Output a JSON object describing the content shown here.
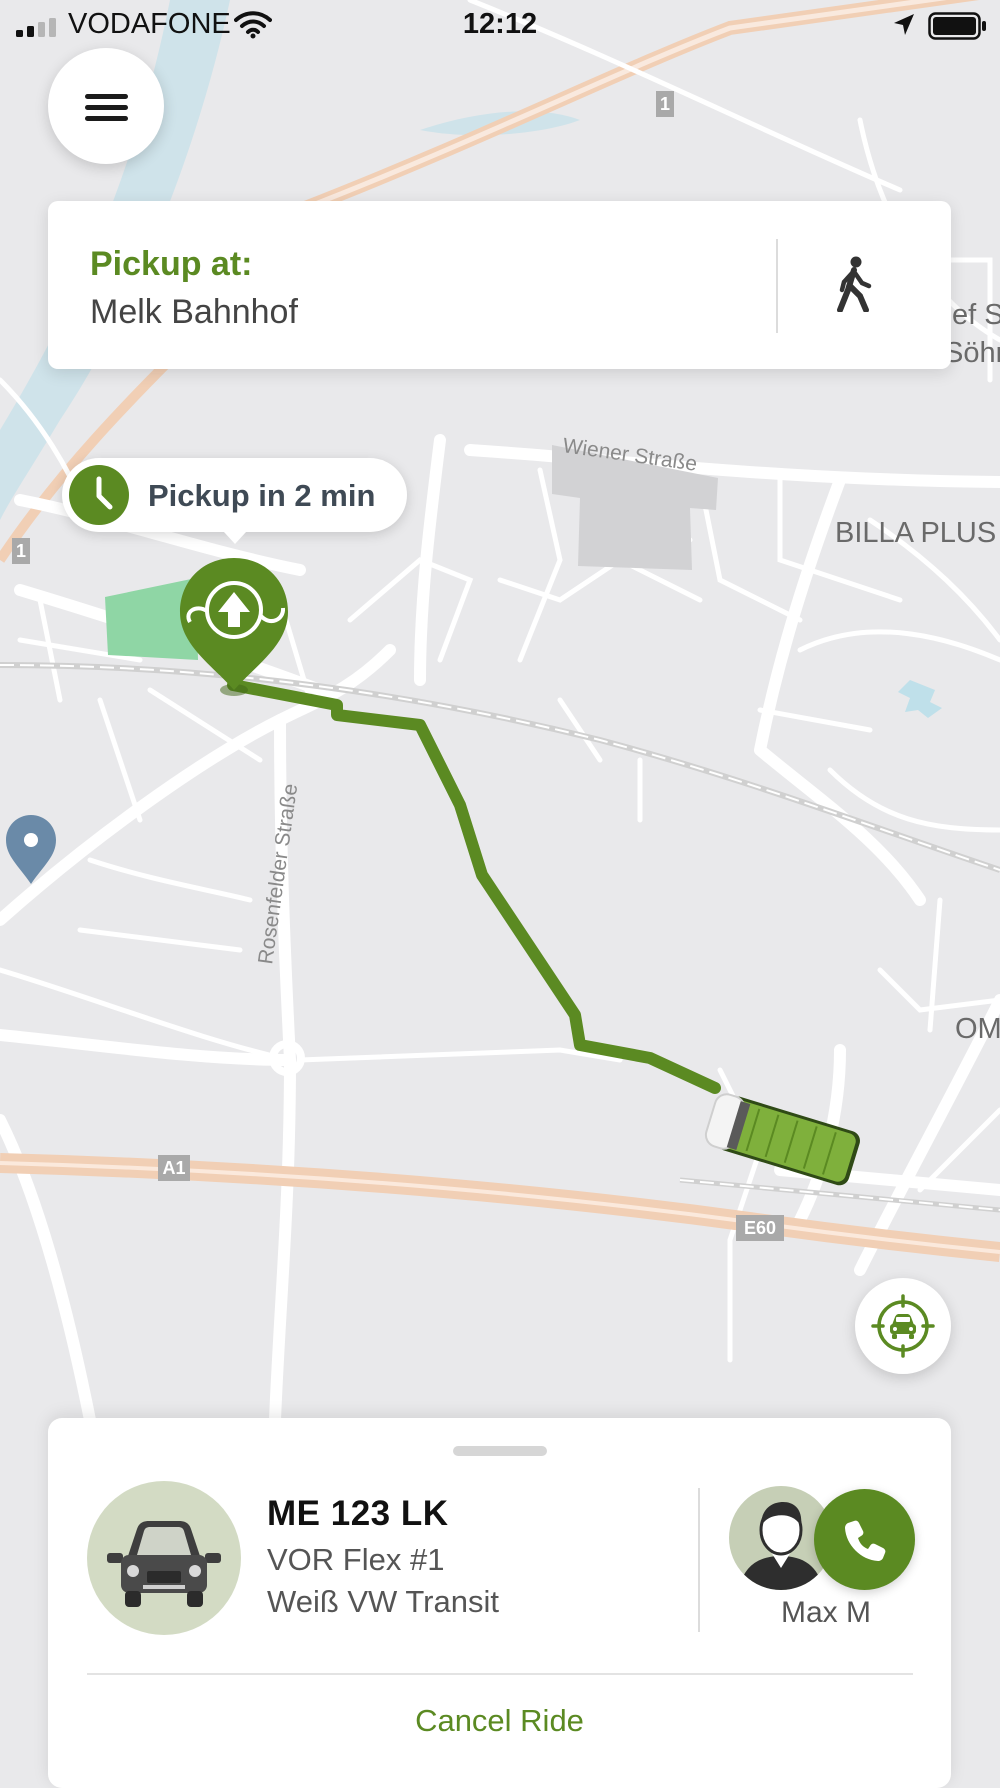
{
  "status_bar": {
    "carrier": "VODAFONE",
    "time": "12:12",
    "icons": [
      "signal-icon",
      "wifi-icon",
      "location-arrow-icon",
      "battery-icon"
    ]
  },
  "map": {
    "street_labels": [
      "Wiener Straße",
      "Rosenfelder Straße"
    ],
    "place_labels": [
      "BILLA PLUS",
      "OM",
      "ef S",
      "Söhn"
    ],
    "road_shields": [
      "A1",
      "E60",
      "1",
      "1"
    ],
    "route_color": "#5b8a22",
    "icons": [
      "pickup-pin-icon",
      "vehicle-icon",
      "map-pin-icon"
    ]
  },
  "menu": {
    "icon": "hamburger-menu-icon"
  },
  "pickup": {
    "label": "Pickup at:",
    "location": "Melk Bahnhof",
    "walk_icon": "walking-person-icon"
  },
  "eta": {
    "text": "Pickup in 2 min",
    "icon": "clock-icon"
  },
  "recenter": {
    "icon": "recenter-car-icon"
  },
  "ride": {
    "plate": "ME 123 LK",
    "vehicle_name": "VOR Flex #1",
    "vehicle_description": "Weiß VW Transit",
    "driver_name": "Max M",
    "cancel_label": "Cancel Ride",
    "icons": [
      "van-icon",
      "driver-avatar-icon",
      "phone-icon"
    ]
  },
  "colors": {
    "accent": "#5b8a22",
    "map_background": "#e9e9eb",
    "road": "#ffffff",
    "highway": "#f1cfb5"
  }
}
